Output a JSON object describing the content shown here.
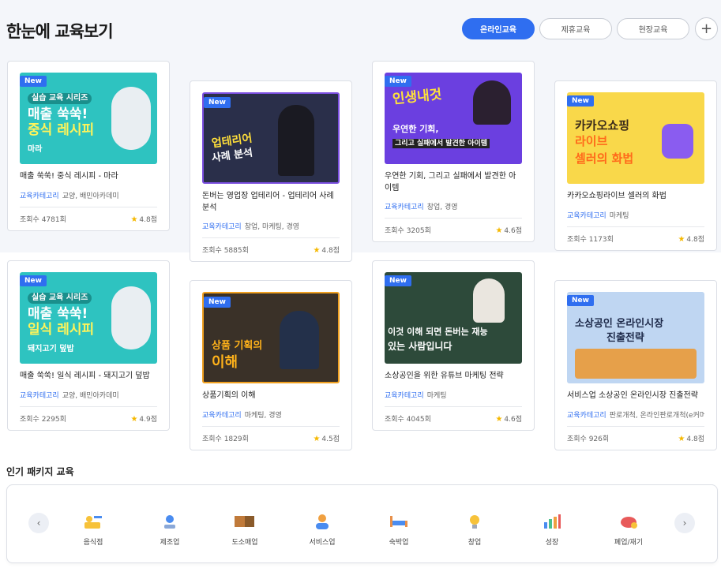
{
  "header": {
    "title": "한눈에 교육보기",
    "tabs": [
      {
        "label": "온라인교육",
        "active": true
      },
      {
        "label": "제휴교육",
        "active": false
      },
      {
        "label": "현장교육",
        "active": false
      }
    ],
    "plus": "+"
  },
  "cards": [
    {
      "badge": "New",
      "thumb_lines": [
        "실습 교육 시리즈",
        "매출 쑥쑥!",
        "중식 레시피",
        "마라"
      ],
      "thumb_bg": "#2ec3c0",
      "title": "매출 쑥쑥! 중식 레시피 - 마라",
      "category": "교육카테고리",
      "tags": "교양, 배민아카데미",
      "views": "조회수 4781회",
      "rating": "4.8점"
    },
    {
      "badge": "New",
      "thumb_lines": [
        "업테리어",
        "사례 분석"
      ],
      "thumb_bg": "#2a2f4a",
      "title": "돈버는 영업장 업테리어 - 업테리어 사례 분석",
      "category": "교육카테고리",
      "tags": "창업, 마케팅, 경영",
      "views": "조회수 5885회",
      "rating": "4.8점"
    },
    {
      "badge": "New",
      "thumb_lines": [
        "인생내것",
        "우연한 기회,",
        "그리고 실패에서 발견한 아이템"
      ],
      "thumb_bg": "#6b3fe0",
      "title": "우연한 기회, 그리고 실패에서 발견한 아이템",
      "category": "교육카테고리",
      "tags": "창업, 경영",
      "views": "조회수 3205회",
      "rating": "4.6점"
    },
    {
      "badge": "New",
      "thumb_lines": [
        "카카오쇼핑",
        "라이브",
        "셀러의 화법"
      ],
      "thumb_bg": "#f9d84a",
      "title": "카카오쇼핑라이브 셀러의 화법",
      "category": "교육카테고리",
      "tags": "마케팅",
      "views": "조회수 1173회",
      "rating": "4.8점"
    },
    {
      "badge": "New",
      "thumb_lines": [
        "실습 교육 시리즈",
        "매출 쑥쑥!",
        "일식 레시피",
        "돼지고기 덮밥"
      ],
      "thumb_bg": "#2ec3c0",
      "title": "매출 쑥쑥! 일식 레시피 - 돼지고기 덮밥",
      "category": "교육카테고리",
      "tags": "교양, 배민아카데미",
      "views": "조회수 2295회",
      "rating": "4.9점"
    },
    {
      "badge": "New",
      "thumb_lines": [
        "상품 기획의",
        "이해"
      ],
      "thumb_bg": "#3a3128",
      "title": "상품기획의 이해",
      "category": "교육카테고리",
      "tags": "마케팅, 경영",
      "views": "조회수 1829회",
      "rating": "4.5점"
    },
    {
      "badge": "New",
      "thumb_lines": [
        "이것 이해 되면 돈버는 재능",
        "있는 사람입니다"
      ],
      "thumb_bg": "#2d4a3a",
      "title": "소상공인을 위한 유튜브 마케팅 전략",
      "category": "교육카테고리",
      "tags": "마케팅",
      "views": "조회수 4045회",
      "rating": "4.6점"
    },
    {
      "badge": "New",
      "thumb_lines": [
        "소상공인 온라인시장",
        "진출전략"
      ],
      "thumb_bg": "#bfd6f2",
      "title": "서비스업 소상공인 온라인시장 진출전략",
      "category": "교육카테고리",
      "tags": "판로개척, 온라인판로개척(e커머스)",
      "views": "조회수 926회",
      "rating": "4.8점"
    }
  ],
  "packages": {
    "title": "인기 패키지 교육",
    "items": [
      {
        "label": "음식점",
        "icon": "chef-icon"
      },
      {
        "label": "제조업",
        "icon": "robot-arm-icon"
      },
      {
        "label": "도소매업",
        "icon": "boxes-icon"
      },
      {
        "label": "서비스업",
        "icon": "service-person-icon"
      },
      {
        "label": "숙박업",
        "icon": "bed-icon"
      },
      {
        "label": "창업",
        "icon": "lightbulb-icon"
      },
      {
        "label": "성장",
        "icon": "bar-chart-icon"
      },
      {
        "label": "폐업/재기",
        "icon": "piggy-bank-icon"
      }
    ]
  },
  "colors": {
    "accent": "#2f6ef0",
    "star": "#f5b800"
  }
}
